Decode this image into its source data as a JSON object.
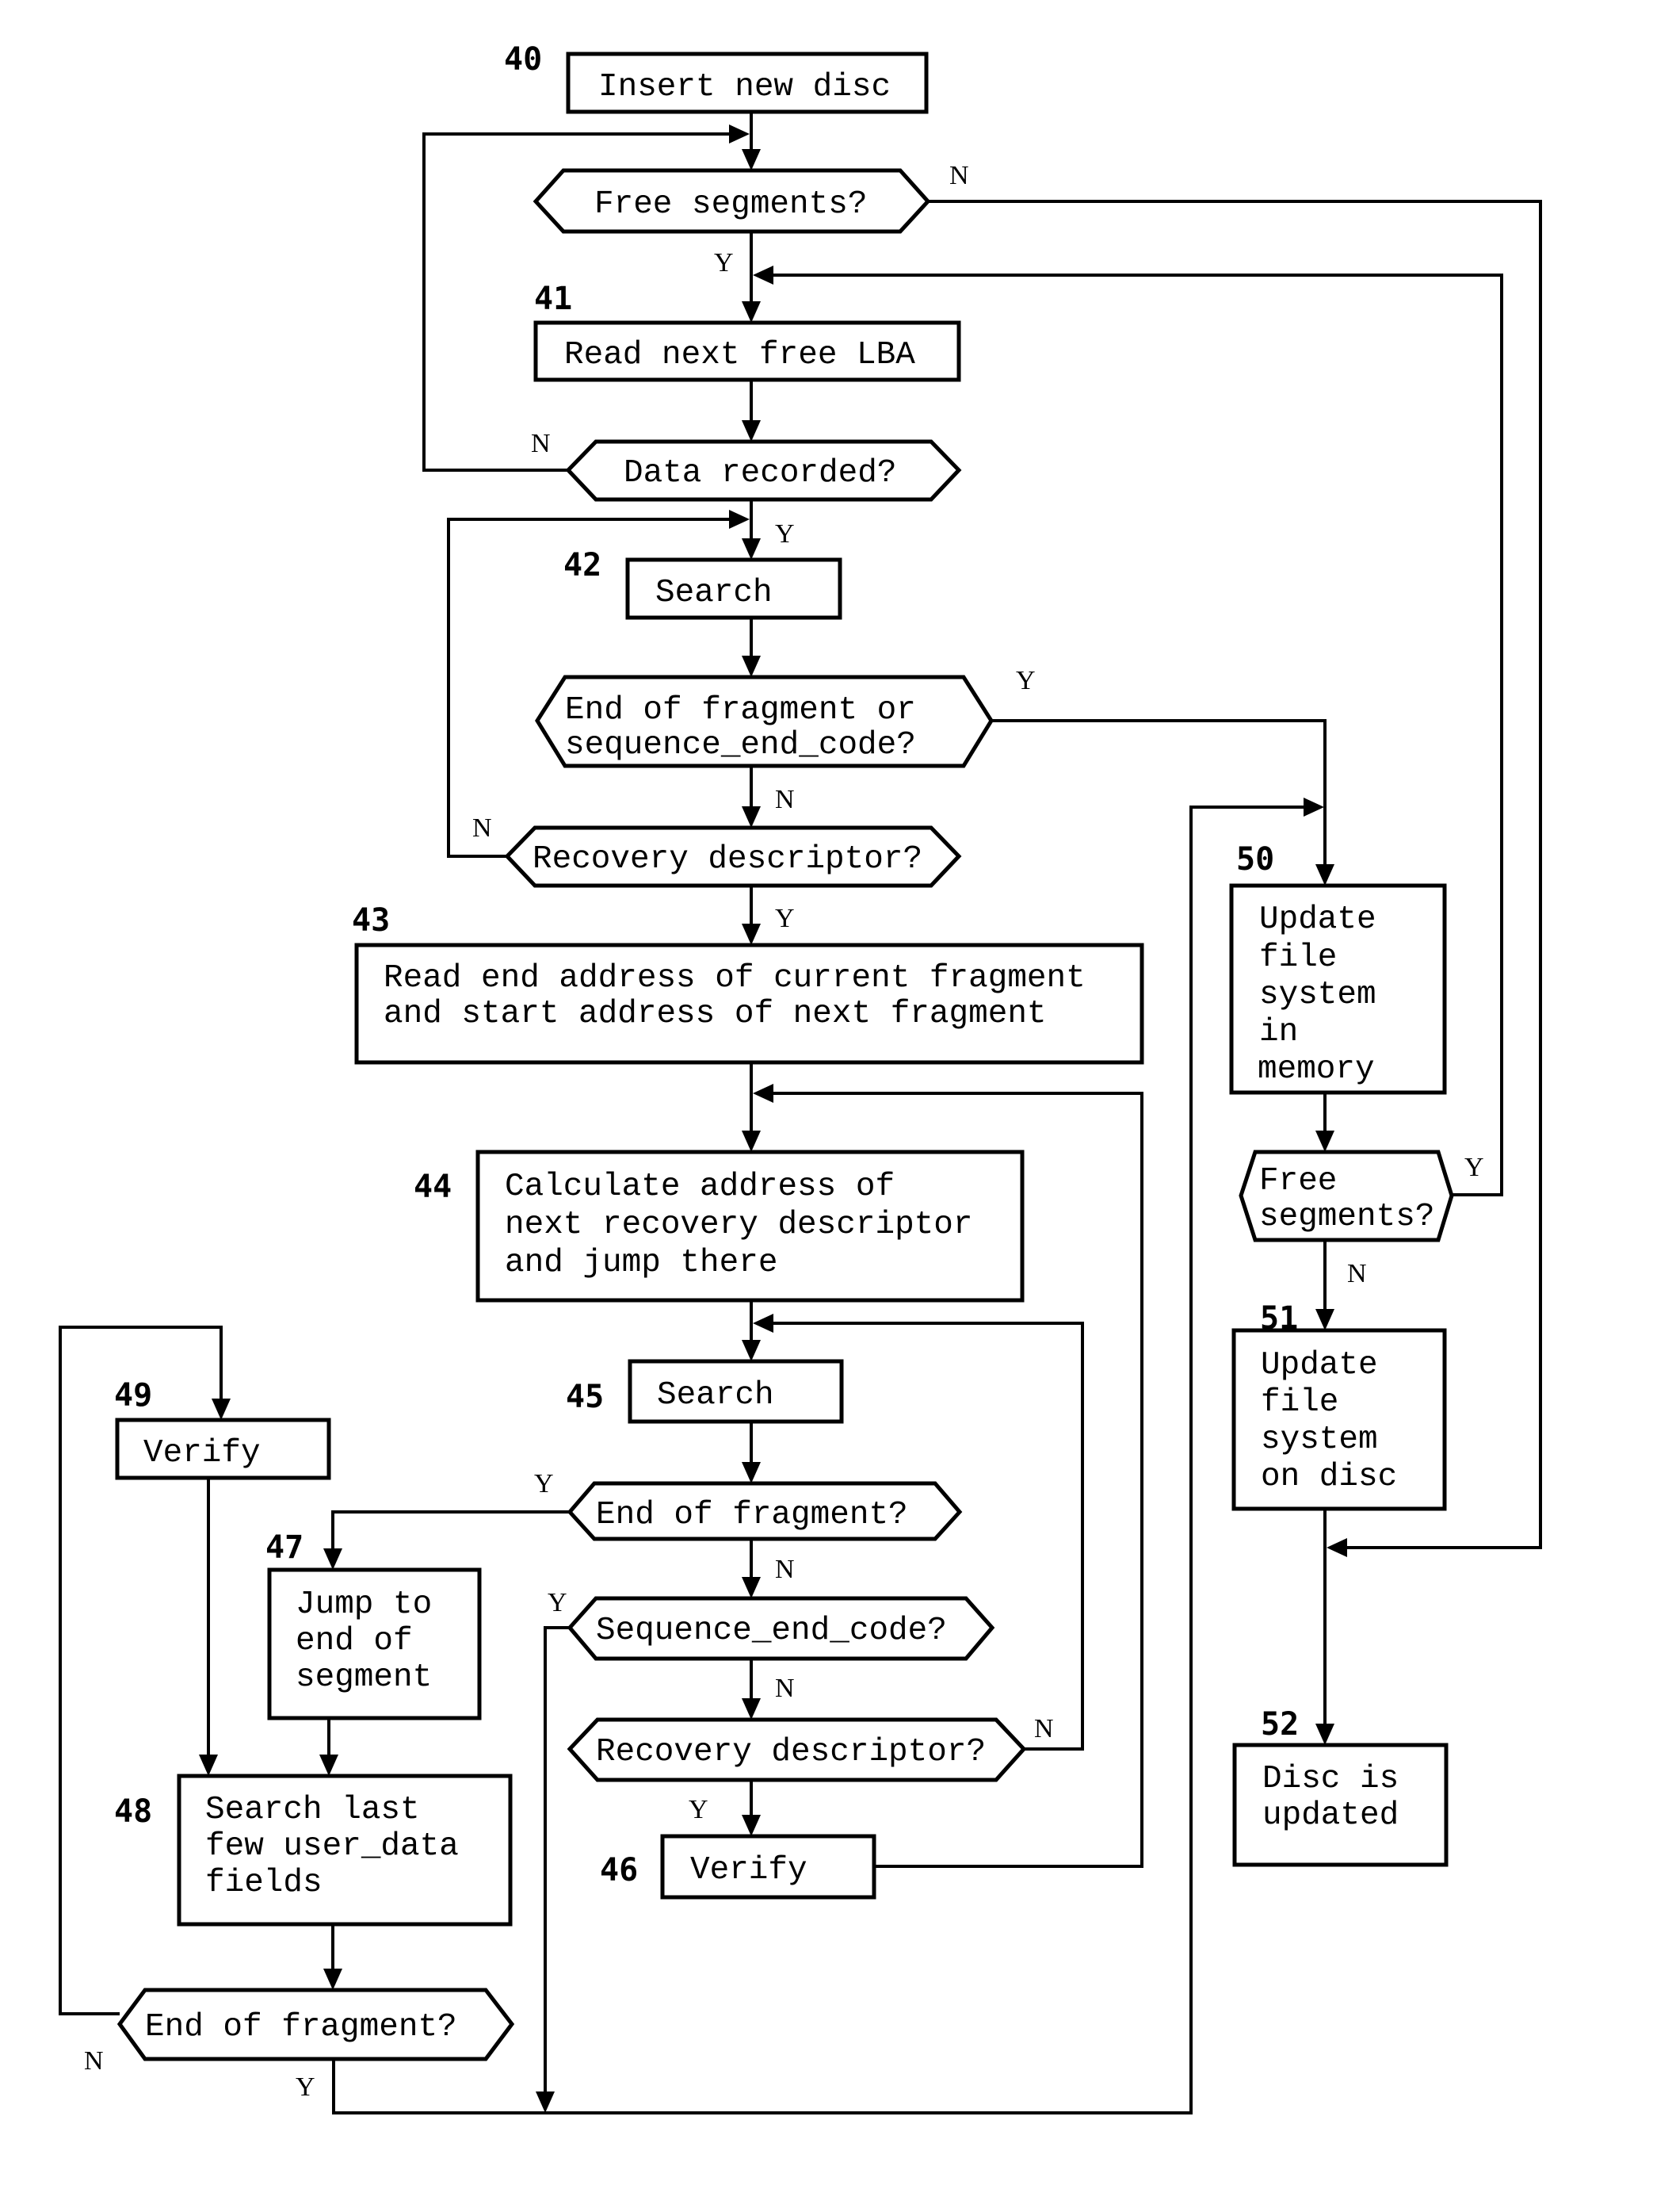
{
  "steps": {
    "s40": {
      "number": "40",
      "lines": [
        "Insert new disc"
      ]
    },
    "q_free1": {
      "lines": [
        "Free segments?"
      ]
    },
    "s41": {
      "number": "41",
      "lines": [
        "Read next free LBA"
      ]
    },
    "q_data": {
      "lines": [
        "Data recorded?"
      ]
    },
    "s42": {
      "number": "42",
      "lines": [
        "Search"
      ]
    },
    "q_eof_seq": {
      "lines": [
        "End of fragment or",
        "sequence_end_code?"
      ]
    },
    "q_recov1": {
      "lines": [
        "Recovery descriptor?"
      ]
    },
    "s43": {
      "number": "43",
      "lines": [
        "Read end address of current fragment",
        "and start address of next fragment"
      ]
    },
    "s44": {
      "number": "44",
      "lines": [
        "Calculate address of",
        "next recovery descriptor",
        "and jump there"
      ]
    },
    "s45": {
      "number": "45",
      "lines": [
        "Search"
      ]
    },
    "q_eof1": {
      "lines": [
        "End of fragment?"
      ]
    },
    "q_seq": {
      "lines": [
        "Sequence_end_code?"
      ]
    },
    "q_recov2": {
      "lines": [
        "Recovery descriptor?"
      ]
    },
    "s46": {
      "number": "46",
      "lines": [
        "Verify"
      ]
    },
    "s47": {
      "number": "47",
      "lines": [
        "Jump to",
        "end of",
        "segment"
      ]
    },
    "s48": {
      "number": "48",
      "lines": [
        "Search last",
        "few user_data",
        "fields"
      ]
    },
    "q_eof2": {
      "lines": [
        "End of fragment?"
      ]
    },
    "s49": {
      "number": "49",
      "lines": [
        "Verify"
      ]
    },
    "s50": {
      "number": "50",
      "lines": [
        "Update",
        "file",
        "system",
        "in",
        "memory"
      ]
    },
    "q_free2": {
      "lines": [
        "Free",
        "segments?"
      ]
    },
    "s51": {
      "number": "51",
      "lines": [
        "Update",
        "file",
        "system",
        "on disc"
      ]
    },
    "s52": {
      "number": "52",
      "lines": [
        "Disc is",
        "updated"
      ]
    }
  },
  "branch_labels": {
    "yes": "Y",
    "no": "N"
  }
}
